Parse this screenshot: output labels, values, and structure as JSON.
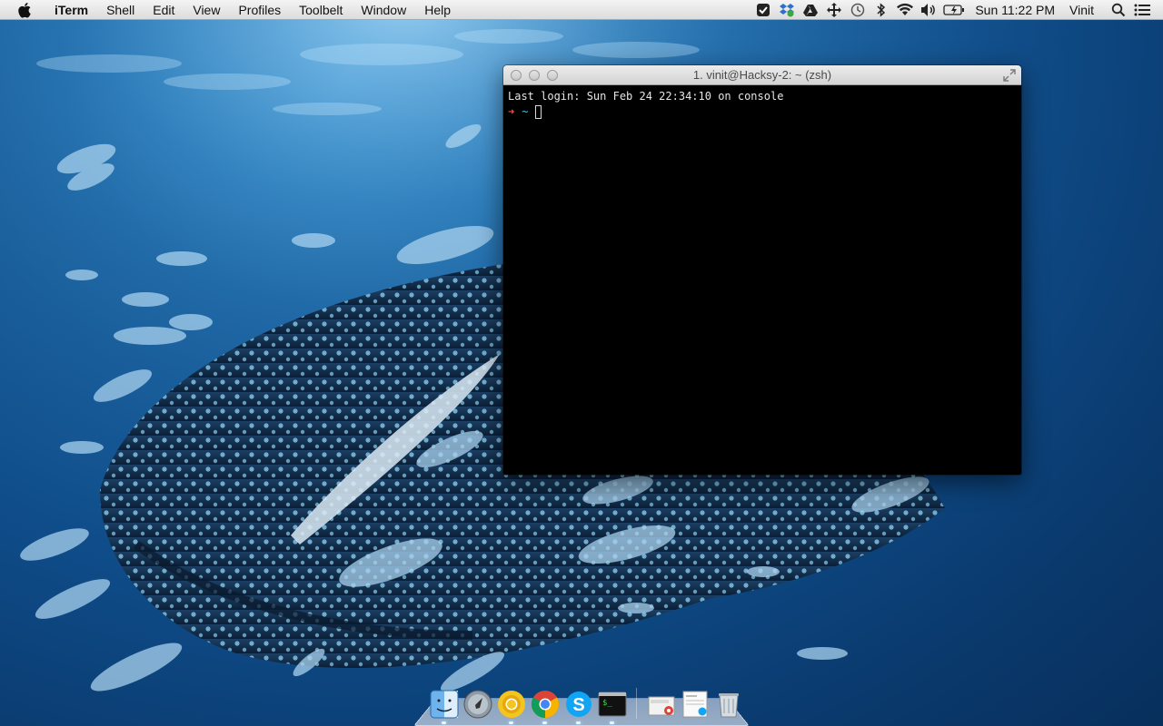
{
  "menubar": {
    "app_name": "iTerm",
    "menus": [
      "Shell",
      "Edit",
      "View",
      "Profiles",
      "Toolbelt",
      "Window",
      "Help"
    ],
    "status_icons": [
      "evernote-icon",
      "dropbox-icon",
      "google-drive-icon",
      "move-icon",
      "time-machine-icon",
      "bluetooth-icon",
      "wifi-icon",
      "volume-icon",
      "battery-icon"
    ],
    "clock": "Sun 11:22 PM",
    "user": "Vinit"
  },
  "terminal": {
    "title": "1. vinit@Hacksy-2: ~ (zsh)",
    "last_login": "Last login: Sun Feb 24 22:34:10 on console",
    "prompt_arrow": "➜",
    "prompt_dir": "~"
  },
  "dock": {
    "apps": [
      "finder-icon",
      "launchpad-icon",
      "chrome-canary-icon",
      "chrome-icon",
      "skype-icon",
      "terminal-icon"
    ],
    "stacks": [
      "downloads-stack-icon",
      "documents-stack-icon",
      "trash-icon"
    ]
  },
  "colors": {
    "prompt_arrow": "#ff4b3b",
    "prompt_dir": "#3fd0e0",
    "terminal_bg": "#000000"
  }
}
